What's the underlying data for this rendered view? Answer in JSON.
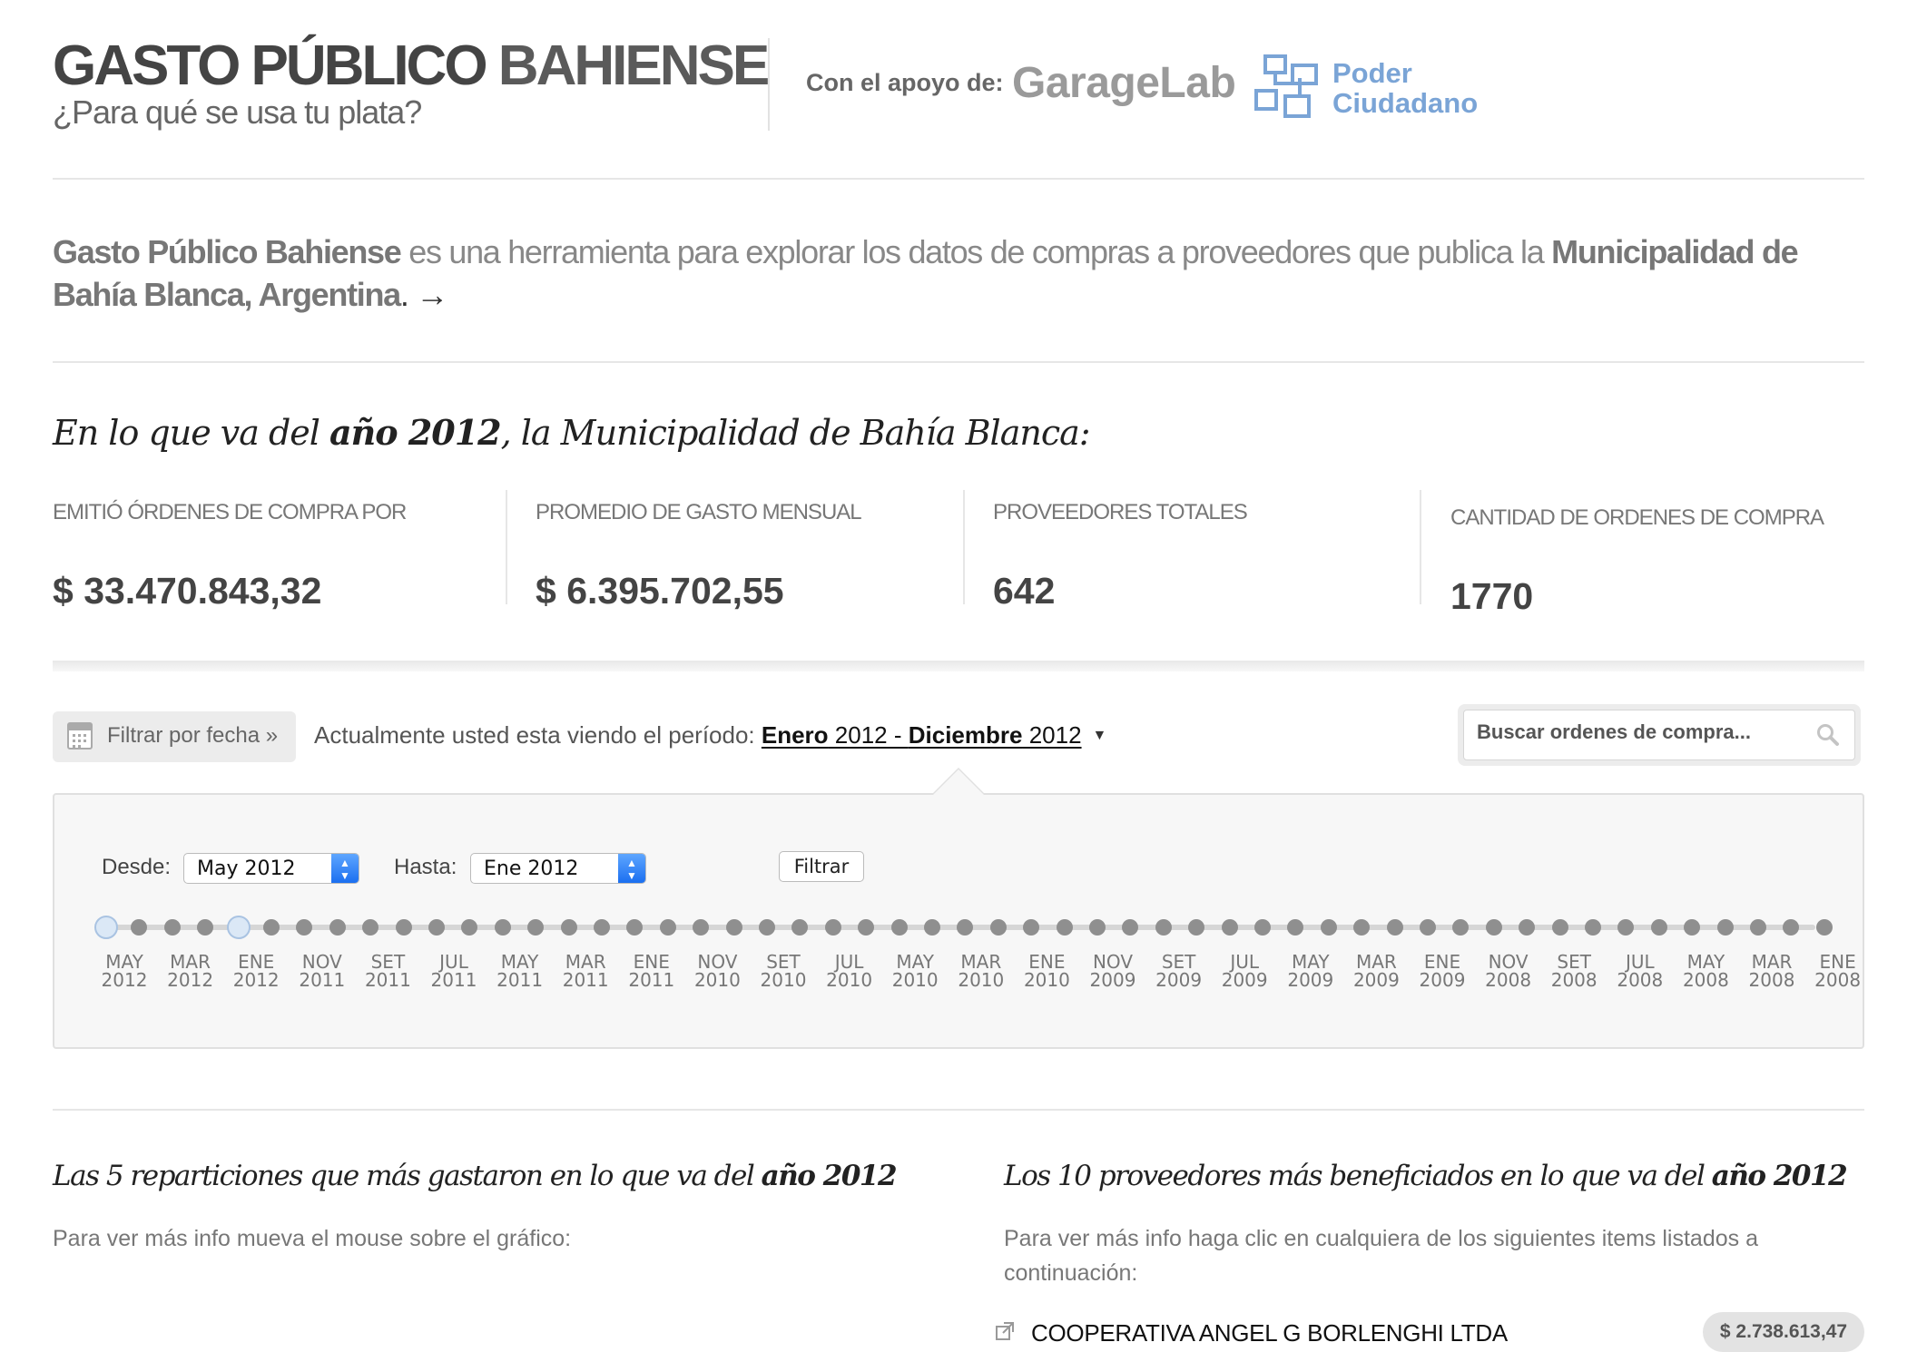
{
  "header": {
    "title_part1": "GASTO PÚBLICO",
    "title_part2": "BAHIENSE",
    "subtitle": "¿Para qué se usa tu plata?",
    "support_label": "Con el apoyo de:",
    "sponsor1": "GarageLab",
    "sponsor2_line1": "Poder",
    "sponsor2_line2": "Ciudadano"
  },
  "intro": {
    "name": "Gasto Público Bahiense",
    "text": " es una herramienta para explorar los datos de compras a proveedores que publica la ",
    "entity": "Municipalidad de Bahía Blanca, Argentina",
    "arrow": ". →"
  },
  "summary": {
    "heading_prefix": "En lo que va del ",
    "heading_year": "año 2012",
    "heading_suffix": ", la Municipalidad de Bahía Blanca:"
  },
  "stats": [
    {
      "label": "EMITIÓ ÓRDENES DE COMPRA POR",
      "value": "$ 33.470.843,32"
    },
    {
      "label": "PROMEDIO DE GASTO MENSUAL",
      "value": "$ 6.395.702,55"
    },
    {
      "label": "PROVEEDORES TOTALES",
      "value": "642"
    },
    {
      "label": "CANTIDAD DE ORDENES DE COMPRA",
      "value": "1770"
    }
  ],
  "filter": {
    "button_label": "Filtrar por fecha »",
    "period_prefix": "Actualmente usted esta viendo el período: ",
    "period_start_month": "Enero",
    "period_start_year": " 2012 - ",
    "period_end_month": "Diciembre",
    "period_end_year": " 2012",
    "caret": "▼"
  },
  "search": {
    "placeholder": "Buscar ordenes de compra..."
  },
  "date_panel": {
    "from_label": "Desde:",
    "from_value": "May 2012",
    "to_label": "Hasta:",
    "to_value": "Ene 2012",
    "filter_button": "Filtrar",
    "timeline_labels": [
      [
        "MAY",
        "2012"
      ],
      [
        "MAR",
        "2012"
      ],
      [
        "ENE",
        "2012"
      ],
      [
        "NOV",
        "2011"
      ],
      [
        "SET",
        "2011"
      ],
      [
        "JUL",
        "2011"
      ],
      [
        "MAY",
        "2011"
      ],
      [
        "MAR",
        "2011"
      ],
      [
        "ENE",
        "2011"
      ],
      [
        "NOV",
        "2010"
      ],
      [
        "SET",
        "2010"
      ],
      [
        "JUL",
        "2010"
      ],
      [
        "MAY",
        "2010"
      ],
      [
        "MAR",
        "2010"
      ],
      [
        "ENE",
        "2010"
      ],
      [
        "NOV",
        "2009"
      ],
      [
        "SET",
        "2009"
      ],
      [
        "JUL",
        "2009"
      ],
      [
        "MAY",
        "2009"
      ],
      [
        "MAR",
        "2009"
      ],
      [
        "ENE",
        "2009"
      ],
      [
        "NOV",
        "2008"
      ],
      [
        "SET",
        "2008"
      ],
      [
        "JUL",
        "2008"
      ],
      [
        "MAY",
        "2008"
      ],
      [
        "MAR",
        "2008"
      ],
      [
        "ENE",
        "2008"
      ]
    ],
    "timeline_steps": 53,
    "selected_range": {
      "start_index": 0,
      "end_index": 4
    }
  },
  "departments": {
    "heading_prefix": "Las 5 reparticiones que más gastaron en lo que va del ",
    "heading_year": "año 2012",
    "hint": "Para ver más info mueva el mouse sobre el gráfico:"
  },
  "providers": {
    "heading_prefix": "Los 10 proveedores más beneficiados en lo que va del ",
    "heading_year": "año 2012",
    "hint": "Para ver más info haga clic en cualquiera de los siguientes items listados a continuación:",
    "items": [
      {
        "name": "COOPERATIVA ANGEL G BORLENGHI LTDA",
        "amount": "$ 2.738.613,47"
      }
    ]
  },
  "colors": {
    "accent_blue": "#7aa4d6",
    "select_blue": "#1b6ff0"
  }
}
